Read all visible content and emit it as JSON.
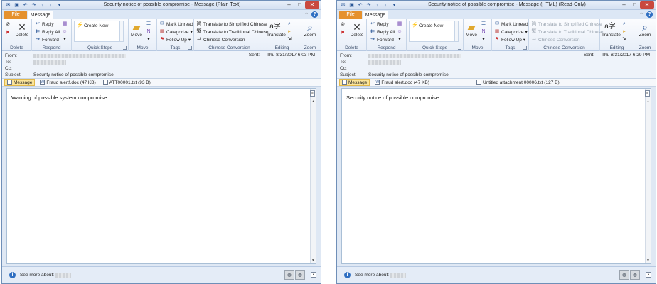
{
  "windows": [
    {
      "title": "Security notice of possible compromise - Message (Plain Text)",
      "tabs": {
        "file": "File",
        "message": "Message"
      },
      "ribbon": {
        "delete": {
          "button": "Delete",
          "group": "Delete"
        },
        "respond": {
          "reply": "Reply",
          "reply_all": "Reply All",
          "forward": "Forward",
          "group": "Respond"
        },
        "quick_steps": {
          "create_new": "Create New",
          "group": "Quick Steps"
        },
        "move": {
          "button": "Move",
          "group": "Move"
        },
        "tags": {
          "mark_unread": "Mark Unread",
          "categorize": "Categorize",
          "follow_up": "Follow Up",
          "group": "Tags"
        },
        "chinese": {
          "simplified": "Translate to Simplified Chinese",
          "traditional": "Translate to Traditional Chinese",
          "conversion": "Chinese Conversion",
          "group": "Chinese Conversion",
          "disabled": false
        },
        "editing": {
          "translate": "Translate",
          "group": "Editing"
        },
        "zoom": {
          "button": "Zoom",
          "group": "Zoom"
        }
      },
      "header": {
        "from_label": "From:",
        "to_label": "To:",
        "cc_label": "Cc:",
        "subject_label": "Subject:",
        "subject": "Security notice of possible compromise",
        "sent_label": "Sent:",
        "sent": "Thu 8/31/2017 6:03 PM"
      },
      "attachments": [
        {
          "name": "Message",
          "selected": true
        },
        {
          "name": "Fraud alert!.doc (47 KB)",
          "selected": false
        },
        {
          "name": "ATT00001.txt (93 B)",
          "selected": false
        }
      ],
      "body_text": "Warning of possible system compromise",
      "people": {
        "see_more": "See more about:"
      }
    },
    {
      "title": "Security notice of possible compromise - Message (HTML) (Read-Only)",
      "tabs": {
        "file": "File",
        "message": "Message"
      },
      "ribbon": {
        "delete": {
          "button": "Delete",
          "group": "Delete"
        },
        "respond": {
          "reply": "Reply",
          "reply_all": "Reply All",
          "forward": "Forward",
          "group": "Respond"
        },
        "quick_steps": {
          "create_new": "Create New",
          "group": "Quick Steps"
        },
        "move": {
          "button": "Move",
          "group": "Move"
        },
        "tags": {
          "mark_unread": "Mark Unread",
          "categorize": "Categorize",
          "follow_up": "Follow Up",
          "group": "Tags"
        },
        "chinese": {
          "simplified": "Translate to Simplified Chinese",
          "traditional": "Translate to Traditional Chinese",
          "conversion": "Chinese Conversion",
          "group": "Chinese Conversion",
          "disabled": true
        },
        "editing": {
          "translate": "Translate",
          "group": "Editing"
        },
        "zoom": {
          "button": "Zoom",
          "group": "Zoom"
        }
      },
      "header": {
        "from_label": "From:",
        "to_label": "To:",
        "cc_label": "Cc:",
        "subject_label": "Subject:",
        "subject": "Security notice of possible compromise",
        "sent_label": "Sent:",
        "sent": "Thu 8/31/2017 6:29 PM"
      },
      "attachments": [
        {
          "name": "Message",
          "selected": true
        },
        {
          "name": "Fraud alert.doc (47 KB)",
          "selected": false
        },
        {
          "name": "Untitled attachment 00006.txt (127 B)",
          "selected": false
        }
      ],
      "body_text": "Security notice of possible compromise",
      "people": {
        "see_more": "See more about:"
      }
    }
  ]
}
